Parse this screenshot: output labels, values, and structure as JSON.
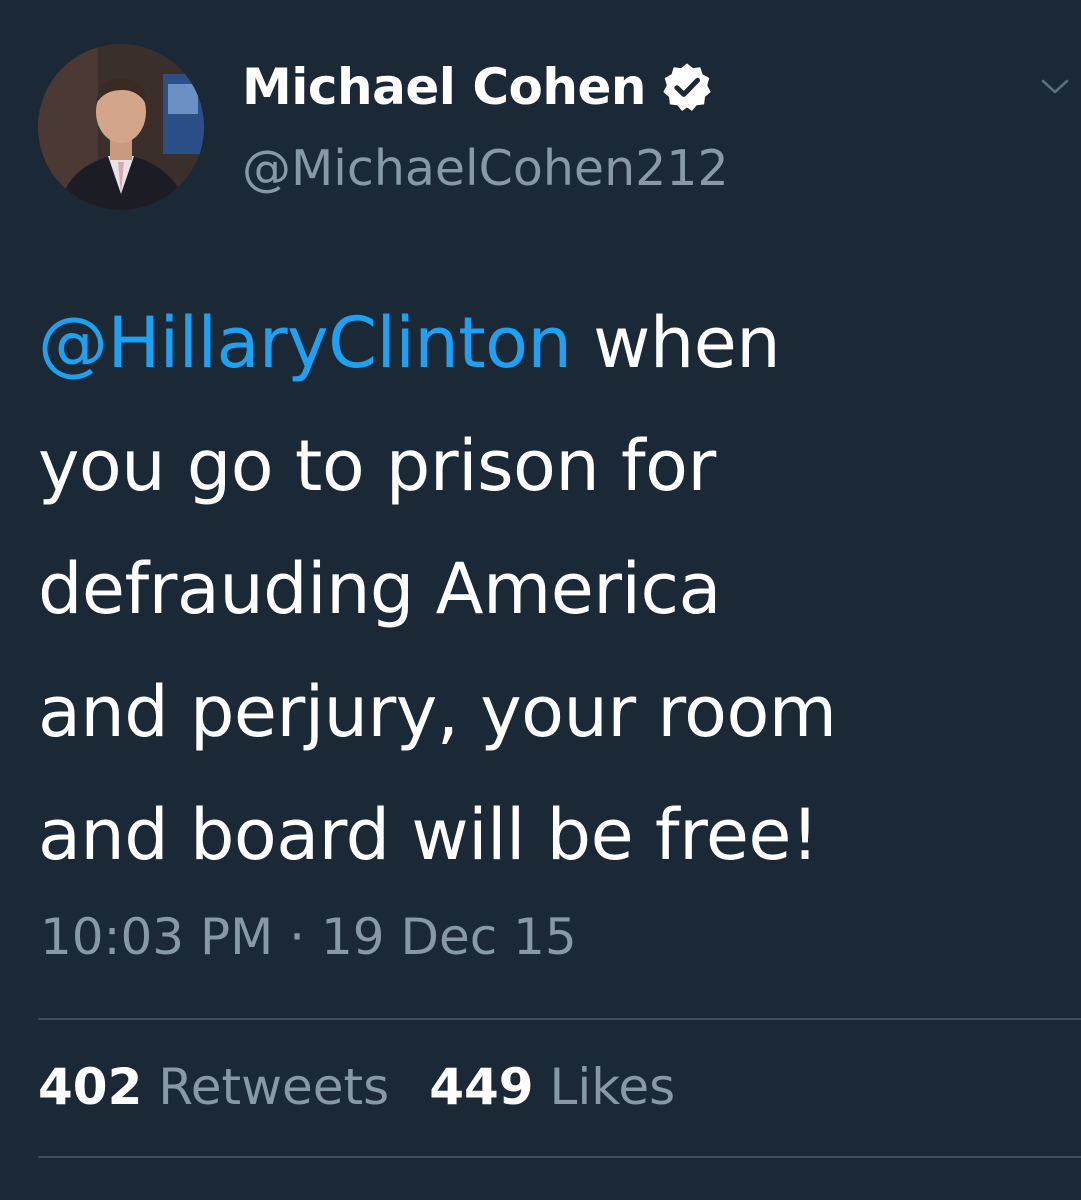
{
  "author": {
    "display_name": "Michael Cohen",
    "handle": "@MichaelCohen212",
    "verified": true,
    "avatar": "profile-photo"
  },
  "tweet": {
    "lines": [
      {
        "mention": "@HillaryClinton",
        "rest": " when"
      },
      {
        "text": "you go to prison for"
      },
      {
        "text": "defrauding America"
      },
      {
        "text": "and perjury, your room"
      },
      {
        "text": "and board will be free!"
      }
    ],
    "timestamp": "10:03 PM · 19 Dec 15"
  },
  "stats": {
    "retweets_count": "402",
    "retweets_label": "Retweets",
    "likes_count": "449",
    "likes_label": "Likes"
  },
  "icons": {
    "verified": "verified-badge-icon",
    "menu": "chevron-down-icon"
  },
  "colors": {
    "background": "#1b2836",
    "mention": "#1da1f2",
    "secondary_text": "#8899a6",
    "primary_text": "#ffffff",
    "divider": "#3d4c5c"
  }
}
